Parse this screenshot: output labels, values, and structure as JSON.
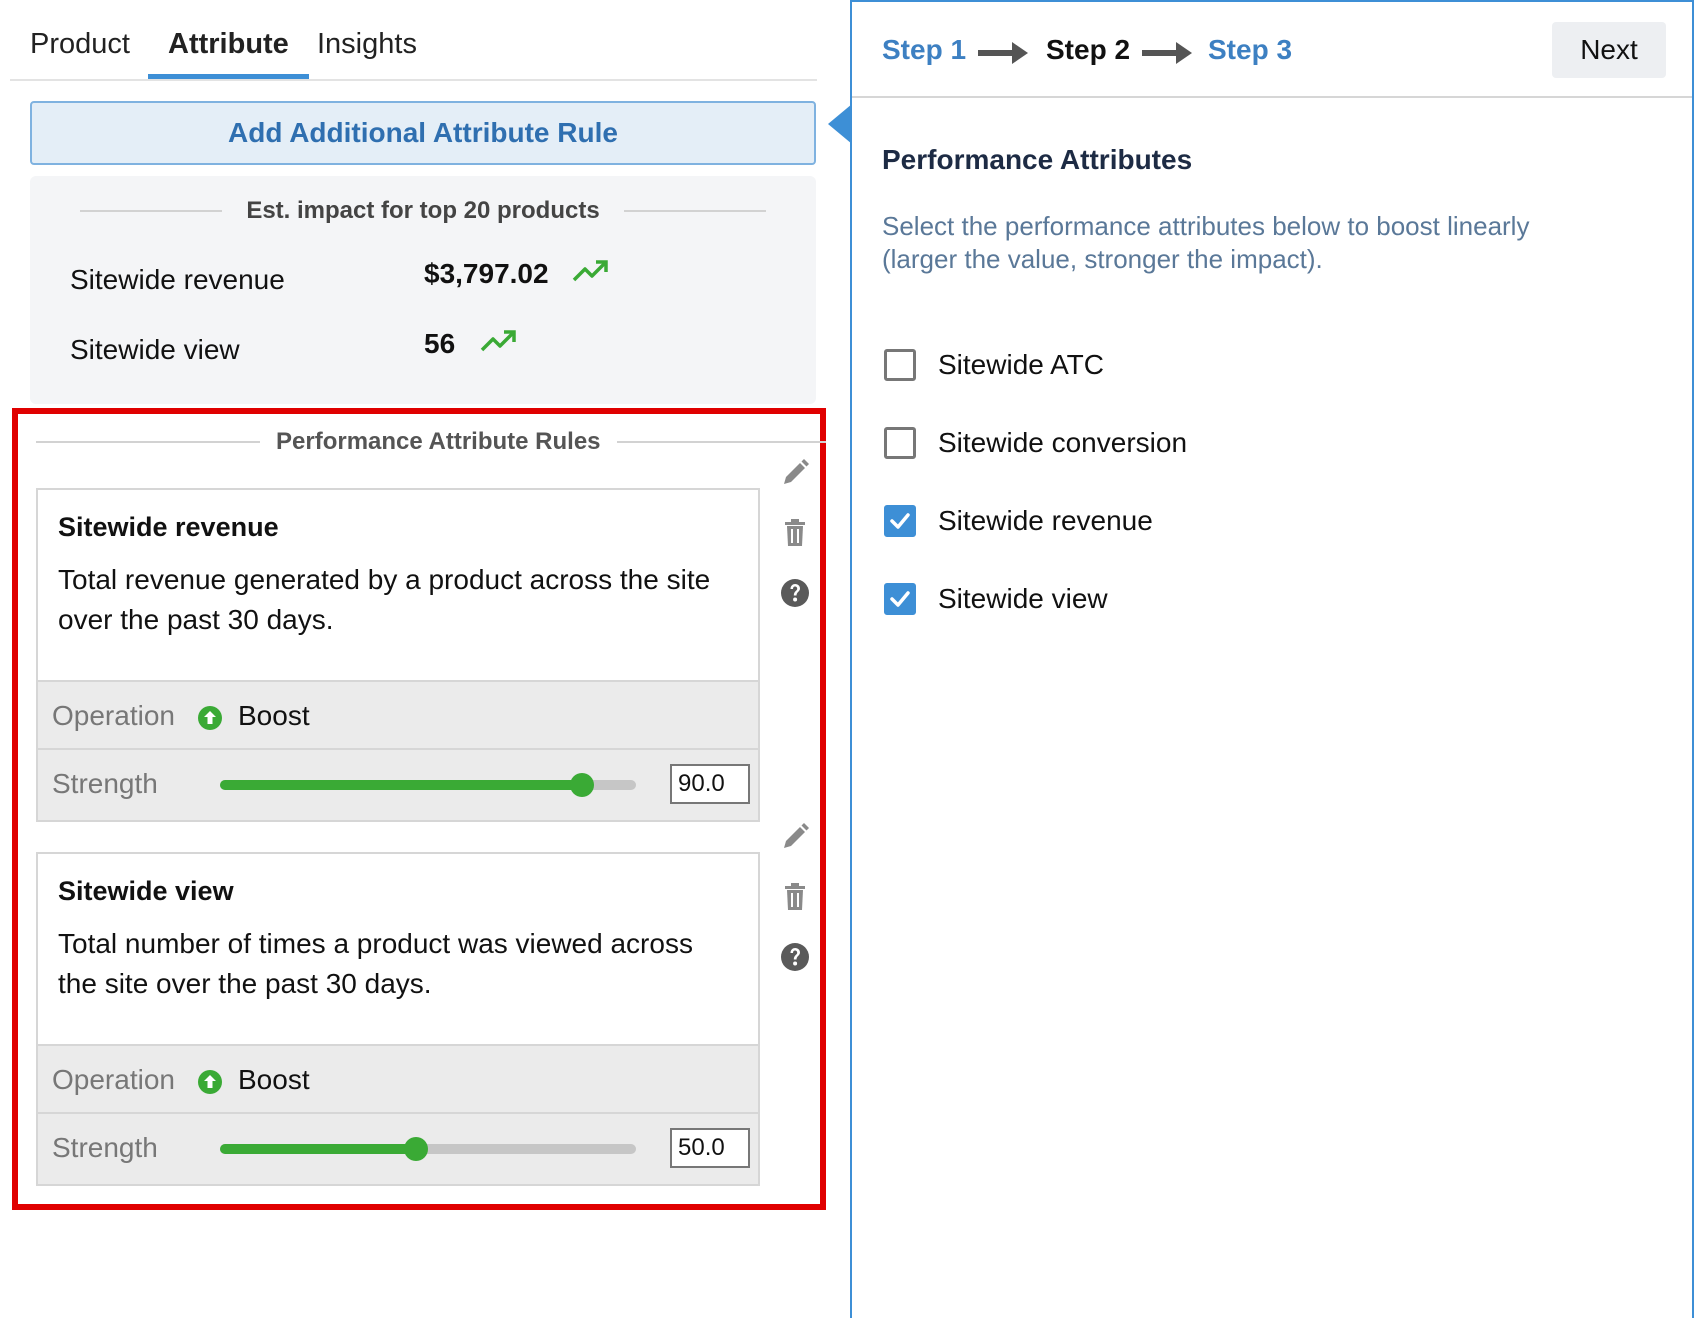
{
  "tabs": [
    {
      "label": "Product"
    },
    {
      "label": "Attribute"
    },
    {
      "label": "Insights"
    }
  ],
  "add_rule_button": "Add Additional Attribute Rule",
  "impact": {
    "title": "Est. impact for top 20 products",
    "metrics": [
      {
        "label": "Sitewide revenue",
        "value": "$3,797.02",
        "trend_icon": "trending-up-icon"
      },
      {
        "label": "Sitewide view",
        "value": "56",
        "trend_icon": "trending-up-icon"
      }
    ]
  },
  "rules": {
    "title": "Performance Attribute Rules",
    "operation_label": "Operation",
    "strength_label": "Strength",
    "items": [
      {
        "name": "Sitewide revenue",
        "description": "Total revenue generated by a product across the site over the past 30 days.",
        "operation": "Boost",
        "strength": "90.0",
        "strength_fraction": 0.87
      },
      {
        "name": "Sitewide view",
        "description": "Total number of times a product was viewed across the site over the past 30 days.",
        "operation": "Boost",
        "strength": "50.0",
        "strength_fraction": 0.47
      }
    ]
  },
  "wizard": {
    "steps": [
      "Step 1",
      "Step 2",
      "Step 3"
    ],
    "current_step": 2,
    "next_label": "Next"
  },
  "performance_attributes": {
    "title": "Performance Attributes",
    "description": "Select the performance attributes below to boost linearly (larger the value, stronger the impact).",
    "options": [
      {
        "label": "Sitewide ATC",
        "checked": false
      },
      {
        "label": "Sitewide conversion",
        "checked": false
      },
      {
        "label": "Sitewide revenue",
        "checked": true
      },
      {
        "label": "Sitewide view",
        "checked": true
      }
    ]
  },
  "colors": {
    "accent": "#3d8fd6",
    "positive": "#3aaa35",
    "highlight_border": "#e00000"
  }
}
